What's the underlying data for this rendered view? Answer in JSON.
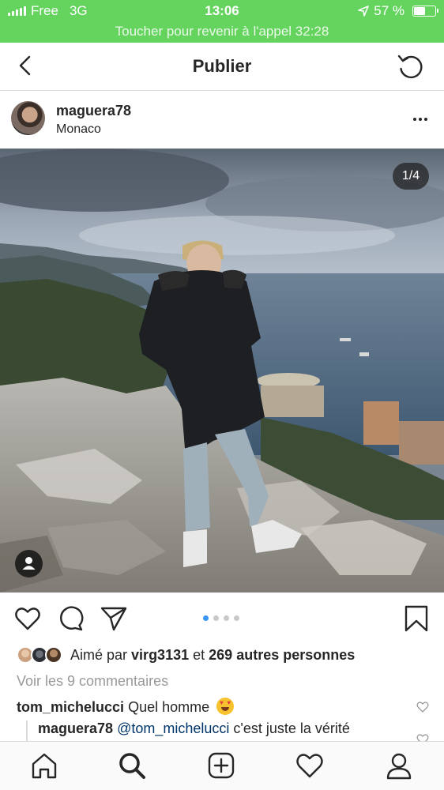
{
  "status_bar": {
    "carrier": "Free",
    "network": "3G",
    "time": "13:06",
    "battery": "57 %",
    "battery_level": 0.57,
    "call_banner": "Toucher pour revenir à l'appel 32:28",
    "background_color": "#64d45f"
  },
  "nav": {
    "title": "Publier",
    "back_icon": "chevron-left-icon",
    "refresh_icon": "refresh-icon"
  },
  "post": {
    "username": "maguera78",
    "location": "Monaco",
    "more_icon": "more-horizontal-icon",
    "photo_counter": "1/4",
    "carousel": {
      "count": 4,
      "current": 1
    },
    "tag_icon": "user-tag-icon"
  },
  "actions": {
    "like_icon": "heart-icon",
    "comment_icon": "comment-icon",
    "share_icon": "send-icon",
    "save_icon": "bookmark-icon"
  },
  "likes": {
    "prefix": "Aimé par",
    "user": "virg3131",
    "conjunction": "et",
    "others": "269 autres personnes"
  },
  "comments": {
    "view_all": "Voir les 9 commentaires",
    "items": [
      {
        "user": "tom_michelucci",
        "text": "Quel homme",
        "emoji": "heart-eyes-emoji"
      }
    ],
    "reply": {
      "user": "maguera78",
      "mention": "@tom_michelucci",
      "text": "c'est juste la vérité"
    }
  },
  "tab_bar": {
    "items": [
      "home-icon",
      "search-icon",
      "add-post-icon",
      "activity-heart-icon",
      "profile-icon"
    ]
  },
  "colors": {
    "accent": "#3897f0",
    "text": "#262626",
    "muted": "#999999",
    "mention": "#003569"
  }
}
